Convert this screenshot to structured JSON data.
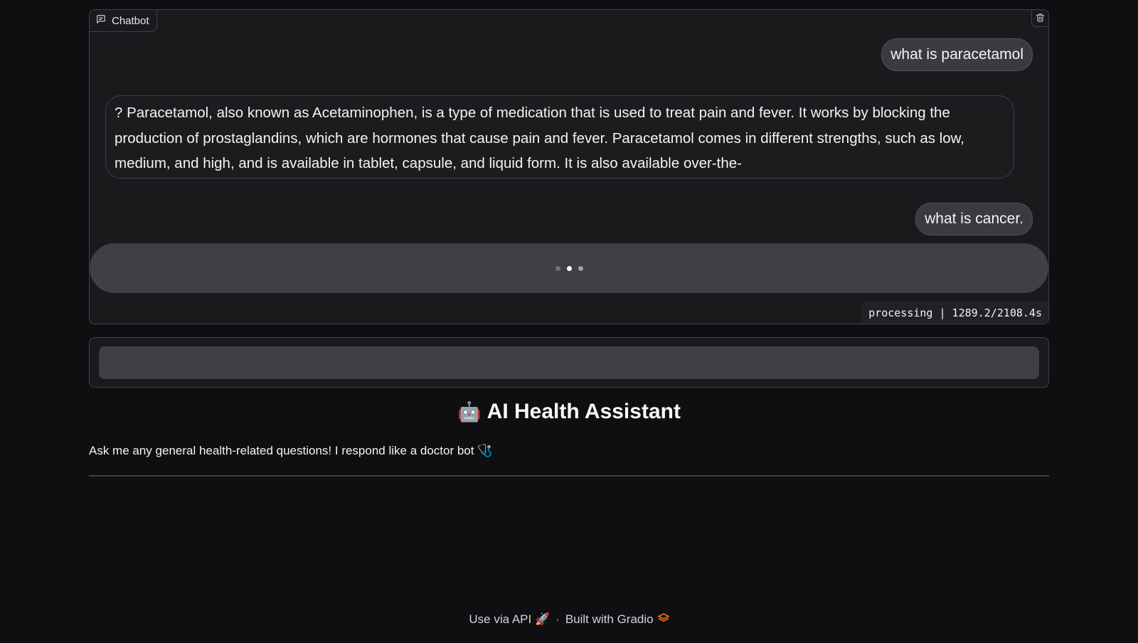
{
  "chatbot": {
    "label": "Chatbot",
    "label_icon": "chat-icon",
    "clear_icon": "trash-icon",
    "messages": [
      {
        "role": "user",
        "text": "what is paracetamol"
      },
      {
        "role": "bot",
        "text": "? Paracetamol, also known as Acetaminophen, is a type of medication that is used to treat pain and fever. It works by blocking the production of prostaglandins, which are hormones that cause pain and fever. Paracetamol comes in different strengths, such as low, medium, and high, and is available in tablet, capsule, and liquid form. It is also available over-the-"
      },
      {
        "role": "user",
        "text": "what is cancer."
      }
    ],
    "status": "processing | 1289.2/2108.4s"
  },
  "input": {
    "value": ""
  },
  "header": {
    "icon": "🤖",
    "title": "AI Health Assistant",
    "description": "Ask me any general health-related questions! I respond like a doctor bot 🩺"
  },
  "footer": {
    "api_link": "Use via API",
    "api_icon": "🚀",
    "separator": "·",
    "built_with": "Built with Gradio",
    "gradio_icon": "gradio-logo-icon"
  },
  "colors": {
    "background": "#0f0f11",
    "panel": "#1a1a1d",
    "bubble": "#3a3a40",
    "border": "#374151",
    "accent": "#f97316"
  }
}
